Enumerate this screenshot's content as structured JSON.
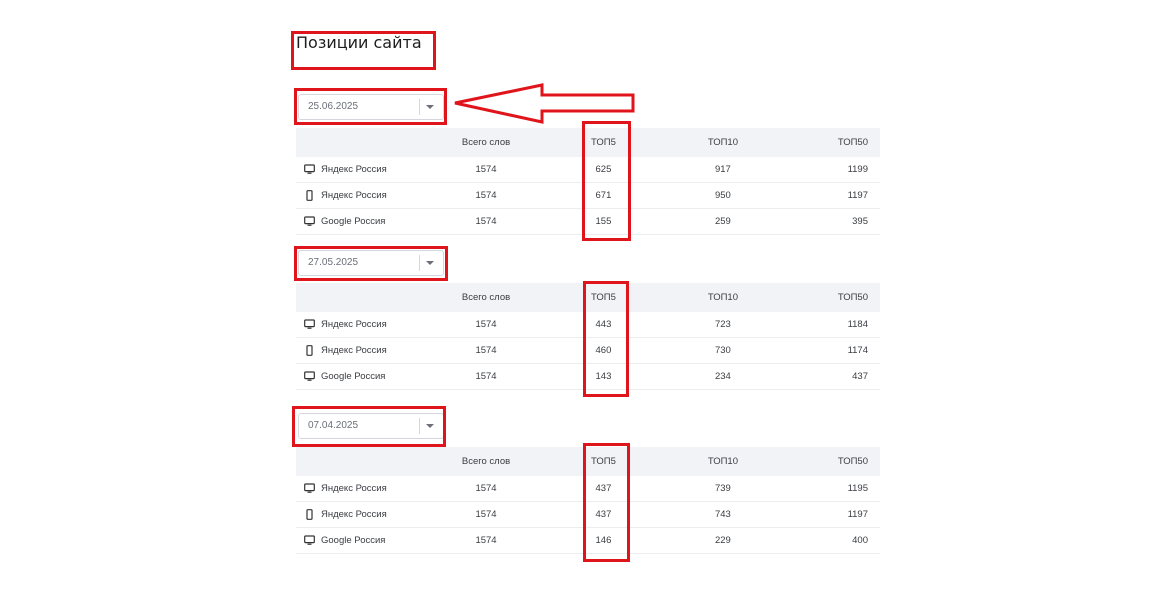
{
  "page": {
    "title": "Позиции сайта"
  },
  "columns": {
    "engine": "",
    "total": "Всего слов",
    "top5": "ТОП5",
    "top10": "ТОП10",
    "top50": "ТОП50"
  },
  "colors": {
    "annotation": "#e0151b",
    "header_bg": "#f2f3f6"
  },
  "sections": [
    {
      "date": "25.06.2025",
      "rows": [
        {
          "icon": "desktop-icon",
          "engine": "Яндекс Россия",
          "total": "1574",
          "top5": "625",
          "top10": "917",
          "top50": "1199"
        },
        {
          "icon": "mobile-icon",
          "engine": "Яндекс Россия",
          "total": "1574",
          "top5": "671",
          "top10": "950",
          "top50": "1197"
        },
        {
          "icon": "desktop-icon",
          "engine": "Google Россия",
          "total": "1574",
          "top5": "155",
          "top10": "259",
          "top50": "395"
        }
      ]
    },
    {
      "date": "27.05.2025",
      "rows": [
        {
          "icon": "desktop-icon",
          "engine": "Яндекс Россия",
          "total": "1574",
          "top5": "443",
          "top10": "723",
          "top50": "1184"
        },
        {
          "icon": "mobile-icon",
          "engine": "Яндекс Россия",
          "total": "1574",
          "top5": "460",
          "top10": "730",
          "top50": "1174"
        },
        {
          "icon": "desktop-icon",
          "engine": "Google Россия",
          "total": "1574",
          "top5": "143",
          "top10": "234",
          "top50": "437"
        }
      ]
    },
    {
      "date": "07.04.2025",
      "rows": [
        {
          "icon": "desktop-icon",
          "engine": "Яндекс Россия",
          "total": "1574",
          "top5": "437",
          "top10": "739",
          "top50": "1195"
        },
        {
          "icon": "mobile-icon",
          "engine": "Яндекс Россия",
          "total": "1574",
          "top5": "437",
          "top10": "743",
          "top50": "1197"
        },
        {
          "icon": "desktop-icon",
          "engine": "Google Россия",
          "total": "1574",
          "top5": "146",
          "top10": "229",
          "top50": "400"
        }
      ]
    }
  ]
}
